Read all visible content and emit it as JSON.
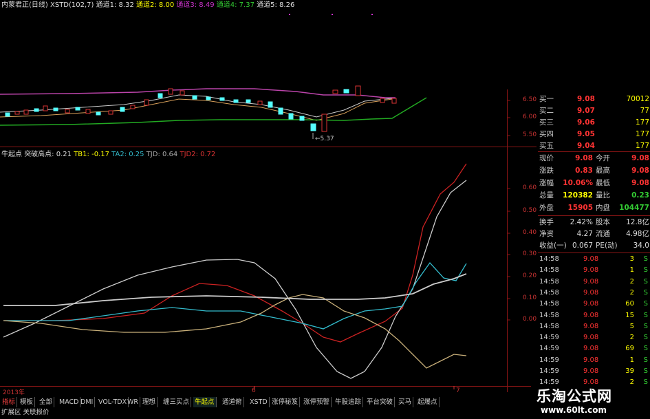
{
  "title_bar": {
    "stock": "内蒙君正(日线)",
    "indicator": "XSTD(102,7)",
    "ch1": "通道1: 8.32",
    "ch2": "通道2: 8.00",
    "ch3": "通道3: 8.49",
    "ch4": "通道4: 7.37",
    "ch5": "通道5: 8.26"
  },
  "main_axis": [
    "6.50",
    "6.00",
    "5.50"
  ],
  "low_marker": "5.37",
  "sub_bar": {
    "name": "牛起点",
    "tpd": "突破高点: 0.21",
    "tb1": "TB1: -0.17",
    "ta2": "TA2: 0.25",
    "tjd": "TJD: 0.64",
    "tjd2": "TJD2: 0.72"
  },
  "sub_axis": [
    "0.60",
    "0.50",
    "0.40",
    "0.30",
    "0.20",
    "0.10",
    "0.00"
  ],
  "x_axis": {
    "year": "2013年",
    "m6": "6",
    "m7": "7"
  },
  "order_book": [
    {
      "label": "买一",
      "price": "9.08",
      "vol": "70012"
    },
    {
      "label": "买二",
      "price": "9.07",
      "vol": "77"
    },
    {
      "label": "买三",
      "price": "9.06",
      "vol": "177"
    },
    {
      "label": "买四",
      "price": "9.05",
      "vol": "177"
    },
    {
      "label": "买五",
      "price": "9.04",
      "vol": "177"
    }
  ],
  "quote": [
    {
      "l1": "现价",
      "v1": "9.08",
      "l2": "今开",
      "v2": "9.08"
    },
    {
      "l1": "涨跌",
      "v1": "0.83",
      "l2": "最高",
      "v2": "9.08"
    },
    {
      "l1": "涨幅",
      "v1": "10.06%",
      "l2": "最低",
      "v2": "9.08"
    },
    {
      "l1": "总量",
      "v1": "120382",
      "l2": "量比",
      "v2": "0.23"
    },
    {
      "l1": "外盘",
      "v1": "15905",
      "l2": "内盘",
      "v2": "104477"
    }
  ],
  "stats": [
    {
      "l1": "换手",
      "v1": "2.42%",
      "l2": "股本",
      "v2": "12.8亿"
    },
    {
      "l1": "净资",
      "v1": "4.27",
      "l2": "流通",
      "v2": "4.98亿"
    },
    {
      "l1": "收益(一)",
      "v1": "0.067",
      "l2": "PE(动)",
      "v2": "34.0"
    }
  ],
  "ticks": [
    {
      "time": "14:58",
      "price": "9.08",
      "vol": "3",
      "side": "S"
    },
    {
      "time": "14:58",
      "price": "9.08",
      "vol": "1",
      "side": "S"
    },
    {
      "time": "14:58",
      "price": "9.08",
      "vol": "2",
      "side": "S"
    },
    {
      "time": "14:58",
      "price": "9.08",
      "vol": "2",
      "side": "S"
    },
    {
      "time": "14:58",
      "price": "9.08",
      "vol": "60",
      "side": "S"
    },
    {
      "time": "14:58",
      "price": "9.08",
      "vol": "15",
      "side": "S"
    },
    {
      "time": "14:58",
      "price": "9.08",
      "vol": "5",
      "side": "S"
    },
    {
      "time": "14:59",
      "price": "9.08",
      "vol": "2",
      "side": "S"
    },
    {
      "time": "14:59",
      "price": "9.08",
      "vol": "69",
      "side": "S"
    },
    {
      "time": "14:59",
      "price": "9.08",
      "vol": "1",
      "side": "S"
    },
    {
      "time": "14:59",
      "price": "9.08",
      "vol": "39",
      "side": "S"
    },
    {
      "time": "14:59",
      "price": "9.08",
      "vol": "2",
      "side": "S"
    }
  ],
  "tabs": [
    "指标",
    "模板",
    "全部",
    "MACD",
    "DMI",
    "VOL-TDX",
    "WR",
    "理想",
    "缠三买点",
    "牛起点",
    "通道俯",
    "XSTD",
    "涨停秘笈",
    "涨停预警",
    "牛股追踪",
    "平台突破",
    "买马",
    "起爆点"
  ],
  "bottom_left": {
    "expand": "扩展区",
    "related": "关联报价"
  },
  "watermark": {
    "cn": "乐淘公式网",
    "url": "www.60lt.com"
  },
  "colors": {
    "red": "#d22",
    "white": "#ddd",
    "cyan": "#3bc",
    "yellow": "#cc9",
    "green": "#2a2"
  }
}
